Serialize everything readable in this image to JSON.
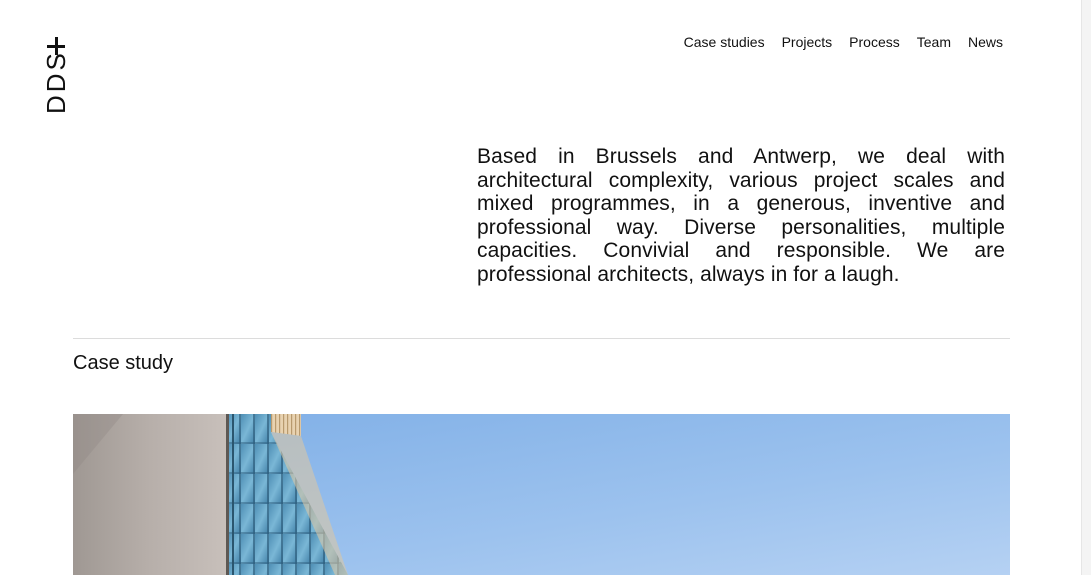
{
  "logo": {
    "text": "DDS"
  },
  "nav": {
    "items": [
      {
        "label": "Case studies"
      },
      {
        "label": "Projects"
      },
      {
        "label": "Process"
      },
      {
        "label": "Team"
      },
      {
        "label": "News"
      }
    ]
  },
  "intro": {
    "text": "Based in Brussels and Antwerp, we deal with architectural complexity, various project scales and mixed programmes, in a generous, inventive and professional way. Diverse personalities, multiple capacities. Convivial and responsible. We are professional architects, always in for a laugh."
  },
  "case_study": {
    "title": "Case study"
  }
}
